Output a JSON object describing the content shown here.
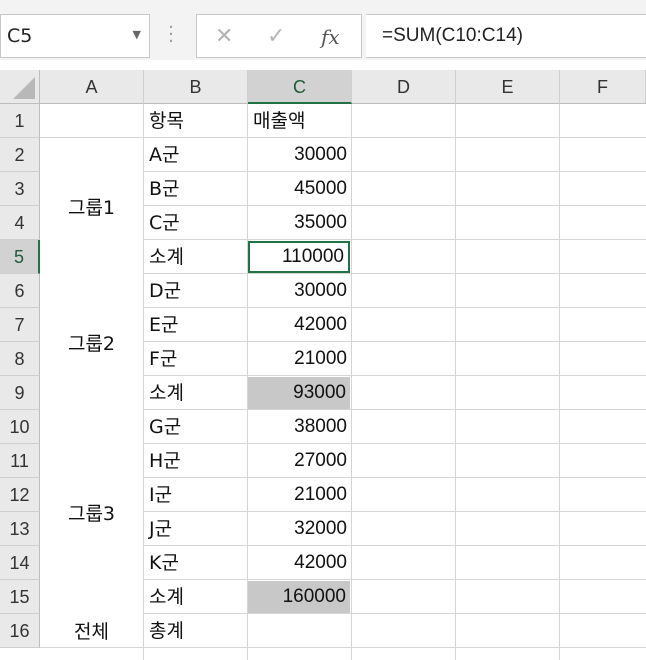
{
  "name_box": {
    "value": "C5",
    "dropdown_icon": "chevron-down-icon"
  },
  "formula_buttons": {
    "cancel_icon": "x-icon",
    "enter_icon": "checkmark-icon",
    "function_label": "fx"
  },
  "formula": "=SUM(C10:C14)",
  "columns": [
    "A",
    "B",
    "C",
    "D",
    "E",
    "F"
  ],
  "rows": [
    "1",
    "2",
    "3",
    "4",
    "5",
    "6",
    "7",
    "8",
    "9",
    "10",
    "11",
    "12",
    "13",
    "14",
    "15",
    "16"
  ],
  "selected_column": "C",
  "selected_row": "5",
  "groups": [
    {
      "label": "그룹1"
    },
    {
      "label": "그룹2"
    },
    {
      "label": "그룹3"
    },
    {
      "label": "전체"
    }
  ],
  "header": {
    "item": "항목",
    "sales": "매출액"
  },
  "items": [
    {
      "name": "A군",
      "value": "30000"
    },
    {
      "name": "B군",
      "value": "45000"
    },
    {
      "name": "C군",
      "value": "35000"
    },
    {
      "name": "소계",
      "value": "110000"
    },
    {
      "name": "D군",
      "value": "30000"
    },
    {
      "name": "E군",
      "value": "42000"
    },
    {
      "name": "F군",
      "value": "21000"
    },
    {
      "name": "소계",
      "value": "93000"
    },
    {
      "name": "G군",
      "value": "38000"
    },
    {
      "name": "H군",
      "value": "27000"
    },
    {
      "name": "I군",
      "value": "21000"
    },
    {
      "name": "J군",
      "value": "32000"
    },
    {
      "name": "K군",
      "value": "42000"
    },
    {
      "name": "소계",
      "value": "160000"
    },
    {
      "name": "총계",
      "value": ""
    }
  ],
  "colors": {
    "selection": "#217346",
    "subtotal_fill": "#c8c8c8",
    "header_fill": "#e9e9e9"
  }
}
